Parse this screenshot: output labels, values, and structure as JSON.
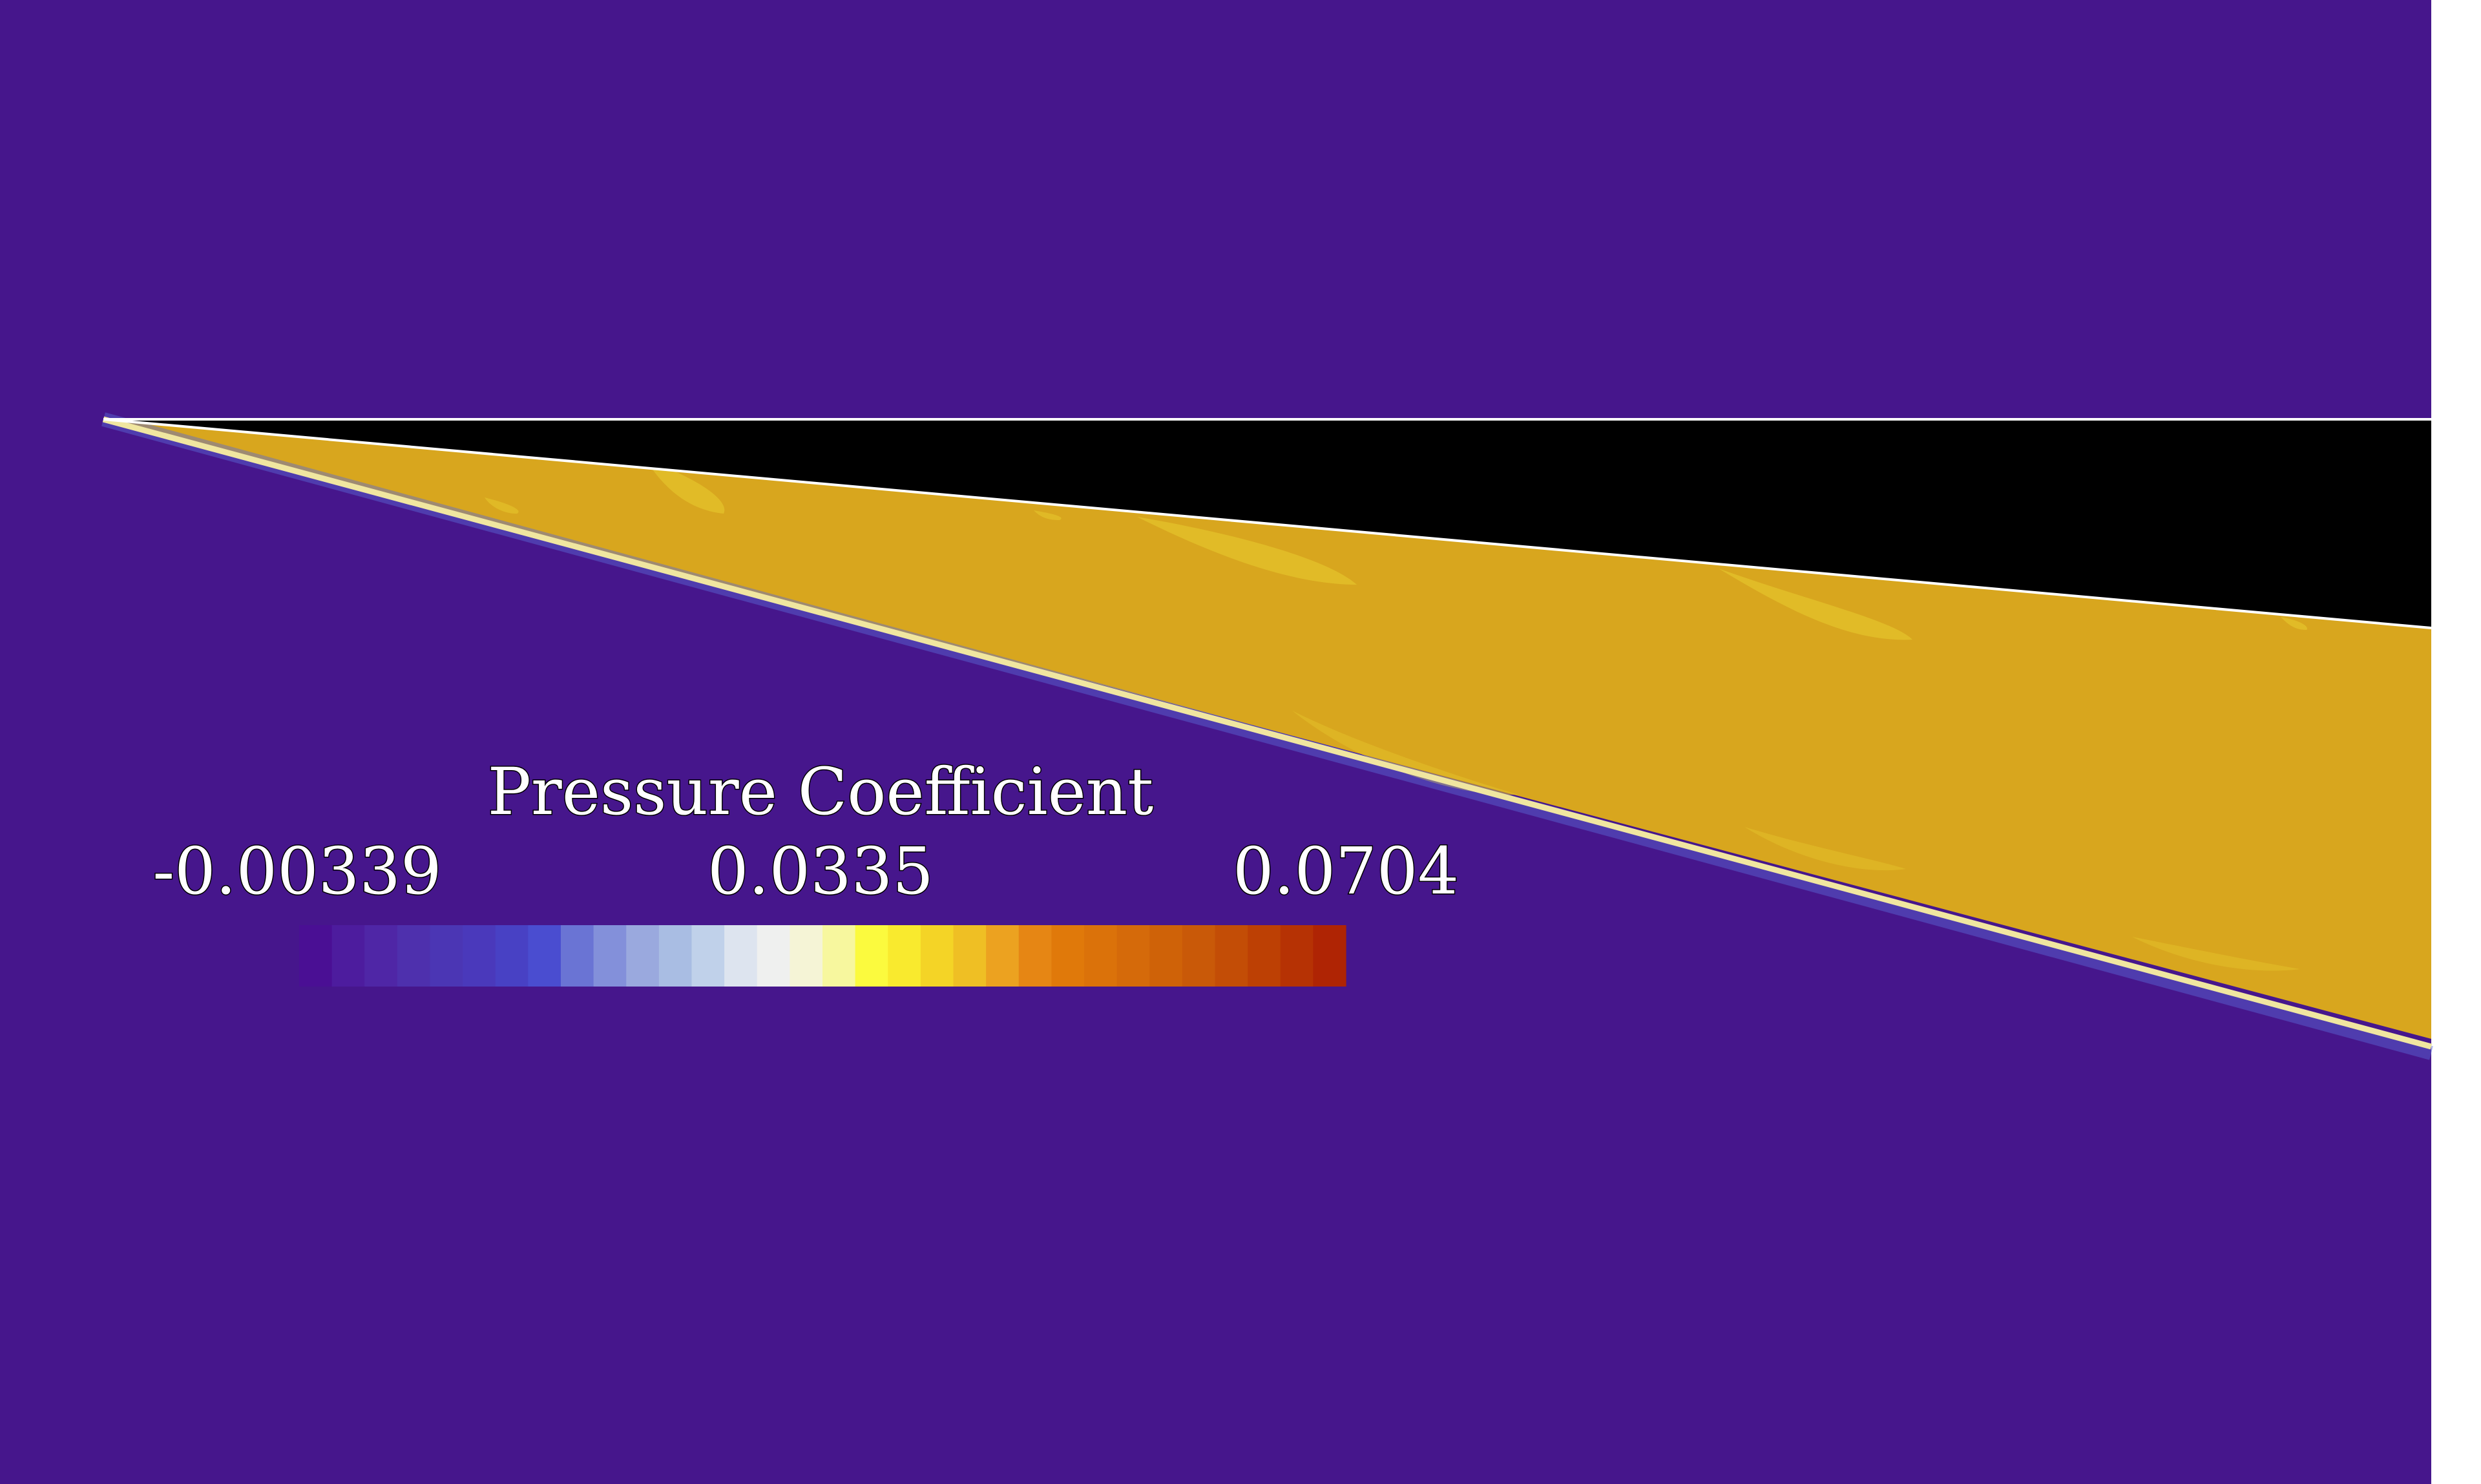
{
  "figure": {
    "background_color": "#46168c",
    "wall_color": "#000000",
    "wall_outline_color": "#ffffff",
    "shock_region_color": "#d8a61e",
    "shock_highlight_color": "#e2be28",
    "shock_edge_color": "#f0e6a0"
  },
  "colorbar": {
    "title": "Pressure Coefficient",
    "min_label": "-0.00339",
    "mid_label": "0.0335",
    "max_label": "0.0704",
    "min": -0.00339,
    "mid": 0.0335,
    "max": 0.0704,
    "colors": [
      "#4a0f94",
      "#4d1c9e",
      "#4f26a6",
      "#4e30ad",
      "#4b36b4",
      "#4a39bb",
      "#4841c4",
      "#4a4dd0",
      "#6a74d4",
      "#8390da",
      "#9aa9de",
      "#a9bde3",
      "#c0d1ea",
      "#dde4ef",
      "#eff0ef",
      "#f5f4d6",
      "#f7f79e",
      "#fbfa3e",
      "#f9ea2e",
      "#f4d426",
      "#efbf24",
      "#eca220",
      "#e68614",
      "#e0790a",
      "#db720a",
      "#d56a0a",
      "#cf6208",
      "#c95908",
      "#c34d06",
      "#bd4004",
      "#b63204",
      "#af2404"
    ]
  }
}
